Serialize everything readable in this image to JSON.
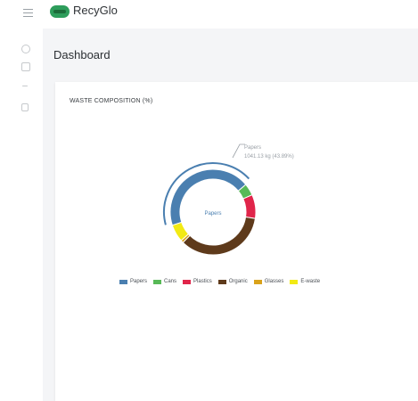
{
  "app": {
    "brand": "RecyGlo"
  },
  "sidebar": {
    "items": [
      "home-icon",
      "list-icon",
      "chart-icon",
      "document-icon"
    ]
  },
  "main": {
    "title": "Dashboard"
  },
  "card": {
    "title": "WASTE COMPOSITION (%)"
  },
  "colors": {
    "Papers": "#4a7fb0",
    "Cans": "#58b957",
    "Plastics": "#e0254a",
    "Organic": "#5e3a1b",
    "Glasses": "#d9a21b",
    "E-waste": "#f2ea14"
  },
  "tooltip": {
    "title": "Papers",
    "value": "1041.13 kg (43.89%)"
  },
  "center_label": "Papers",
  "chart_data": {
    "type": "pie",
    "title": "WASTE COMPOSITION (%)",
    "categories": [
      "Papers",
      "Cans",
      "Plastics",
      "Organic",
      "Glasses",
      "E-waste"
    ],
    "values": [
      43.89,
      4.5,
      9.0,
      35.0,
      1.0,
      6.6
    ],
    "legend": "bottom"
  }
}
